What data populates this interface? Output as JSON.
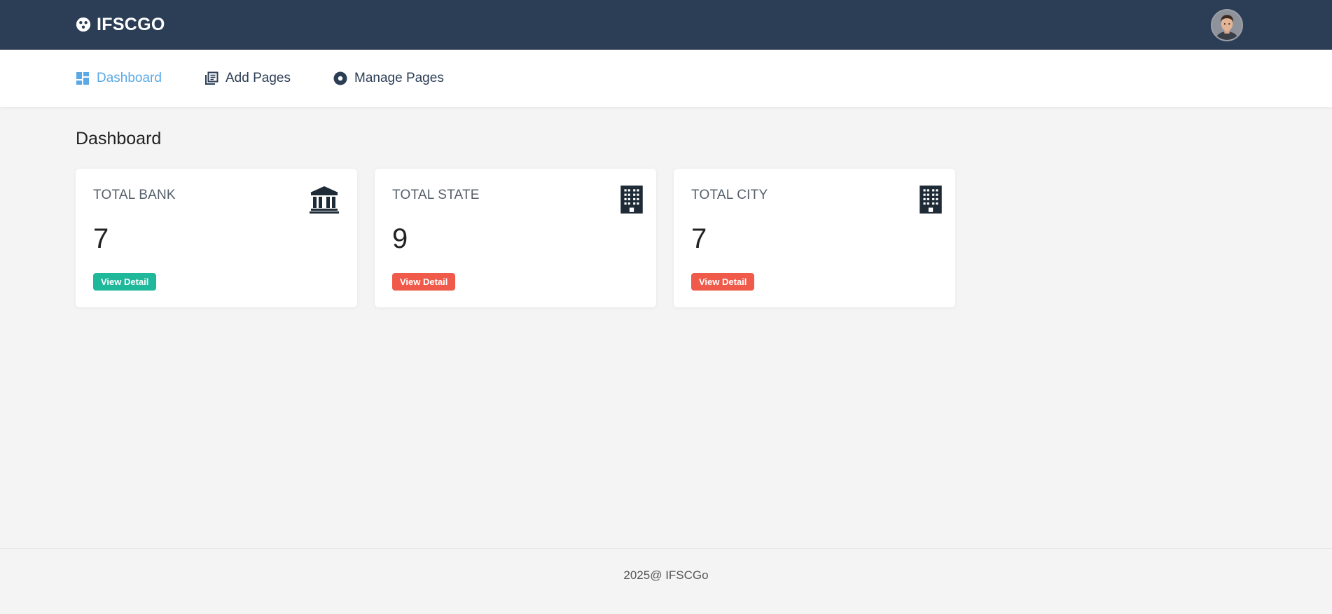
{
  "header": {
    "brand_name": "IFSCGO",
    "brand_icon": "circle-dots-logo-icon",
    "avatar_icon": "user-avatar"
  },
  "nav": {
    "items": [
      {
        "label": "Dashboard",
        "icon": "dashboard-icon",
        "active": true
      },
      {
        "label": "Add Pages",
        "icon": "pages-icon",
        "active": false
      },
      {
        "label": "Manage Pages",
        "icon": "record-icon",
        "active": false
      }
    ]
  },
  "main": {
    "title": "Dashboard",
    "cards": [
      {
        "title": "TOTAL BANK",
        "value": "7",
        "button": "View Detail",
        "icon": "bank-icon",
        "button_color": "#1fb89a"
      },
      {
        "title": "TOTAL STATE",
        "value": "9",
        "button": "View Detail",
        "icon": "building-icon",
        "button_color": "#f05a4a"
      },
      {
        "title": "TOTAL CITY",
        "value": "7",
        "button": "View Detail",
        "icon": "building-icon",
        "button_color": "#f05a4a"
      }
    ]
  },
  "footer": {
    "text": "2025@ IFSCGo"
  },
  "colors": {
    "topbar": "#2c3e55",
    "active_nav": "#5aa9e6",
    "background": "#f4f4f4"
  }
}
